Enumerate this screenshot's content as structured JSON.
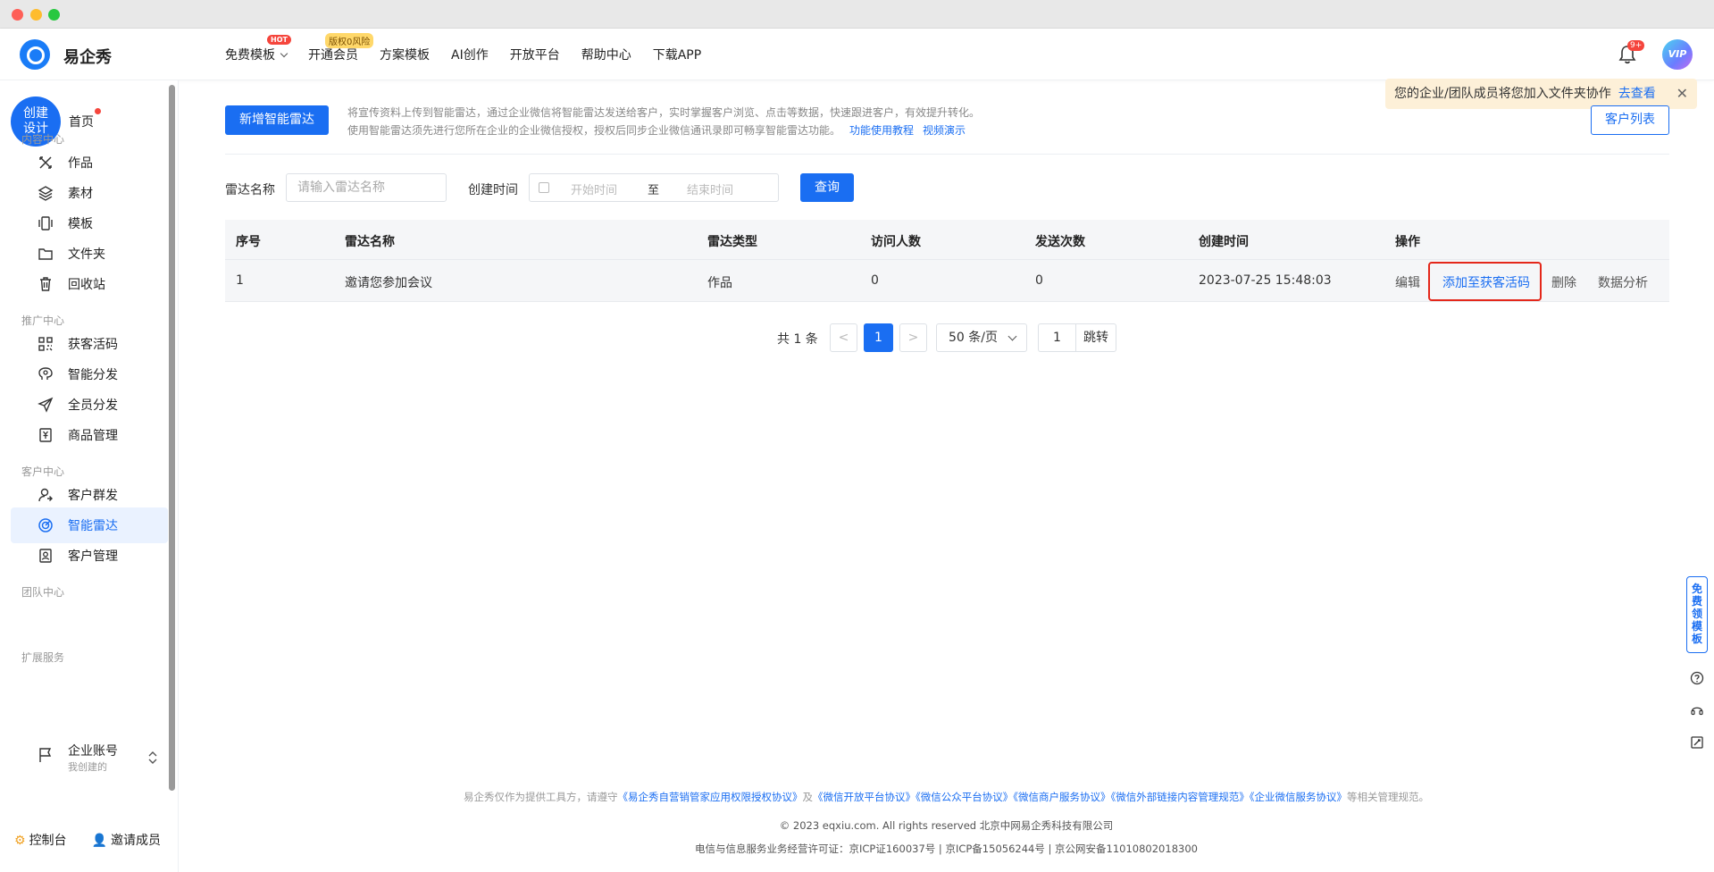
{
  "header": {
    "brand": "易企秀",
    "nav": [
      {
        "label": "免费模板",
        "badge": "HOT"
      },
      {
        "label": "开通会员",
        "badge": "版权0风险"
      },
      {
        "label": "方案模板"
      },
      {
        "label": "AI创作"
      },
      {
        "label": "开放平台"
      },
      {
        "label": "帮助中心"
      },
      {
        "label": "下载APP"
      }
    ],
    "bell_badge": "9+",
    "avatar_label": "VIP"
  },
  "toast": {
    "text": "您的企业/团队成员将您加入文件夹协作",
    "link": "去查看",
    "close": "✕"
  },
  "sidebar": {
    "create_label_1": "创建",
    "create_label_2": "设计",
    "home": "首页",
    "sections": {
      "content": "内容中心",
      "promo": "推广中心",
      "customer": "客户中心",
      "team": "团队中心",
      "ext": "扩展服务"
    },
    "items": {
      "works": "作品",
      "material": "素材",
      "template": "模板",
      "folder": "文件夹",
      "recycle": "回收站",
      "lead_code": "获客活码",
      "smart_dist": "智能分发",
      "all_dist": "全员分发",
      "goods": "商品管理",
      "group_send": "客户群发",
      "radar": "智能雷达",
      "customer_mgmt": "客户管理"
    },
    "enterprise": {
      "label": "企业账号",
      "sub": "我创建的"
    },
    "bottom": {
      "console": "控制台",
      "invite": "邀请成员"
    }
  },
  "main": {
    "new_btn": "新增智能雷达",
    "desc_line1": "将宣传资料上传到智能雷达，通过企业微信将智能雷达发送给客户，实时掌握客户浏览、点击等数据，快速跟进客户，有效提升转化。",
    "desc_line2": "使用智能雷达须先进行您所在企业的企业微信授权，授权后同步企业微信通讯录即可畅享智能雷达功能。",
    "desc_link1": "功能使用教程",
    "desc_link2": "视频演示",
    "customer_list_btn": "客户列表",
    "filter": {
      "name_label": "雷达名称",
      "name_placeholder": "请输入雷达名称",
      "time_label": "创建时间",
      "start_placeholder": "开始时间",
      "to": "至",
      "end_placeholder": "结束时间",
      "query_btn": "查询"
    },
    "table": {
      "headers": [
        "序号",
        "雷达名称",
        "雷达类型",
        "访问人数",
        "发送次数",
        "创建时间",
        "操作"
      ],
      "rows": [
        {
          "index": "1",
          "name": "邀请您参加会议",
          "type": "作品",
          "visitors": "0",
          "sends": "0",
          "created": "2023-07-25 15:48:03"
        }
      ],
      "ops": {
        "edit": "编辑",
        "add_code": "添加至获客活码",
        "delete": "删除",
        "analysis": "数据分析"
      }
    },
    "pagination": {
      "total": "共 1 条",
      "prev": "<",
      "current": "1",
      "next": ">",
      "page_size": "50 条/页",
      "jump_value": "1",
      "jump_btn": "跳转"
    }
  },
  "footer": {
    "line1_prefix": "易企秀仅作为提供工具方，请遵守",
    "line1_link1": "《易企秀自营销管家应用权限授权协议》",
    "line1_and": "及",
    "line1_links": "《微信开放平台协议》《微信公众平台协议》《微信商户服务协议》《微信外部链接内容管理规范》《企业微信服务协议》",
    "line1_suffix": "等相关管理规范。",
    "line2": "© 2023 eqxiu.com. All rights reserved 北京中网易企秀科技有限公司",
    "line3": "电信与信息服务业务经营许可证：京ICP证160037号 | 京ICP备15056244号 | 京公网安备11010802018300"
  },
  "right_tools": {
    "free_template": "免费领模板"
  }
}
